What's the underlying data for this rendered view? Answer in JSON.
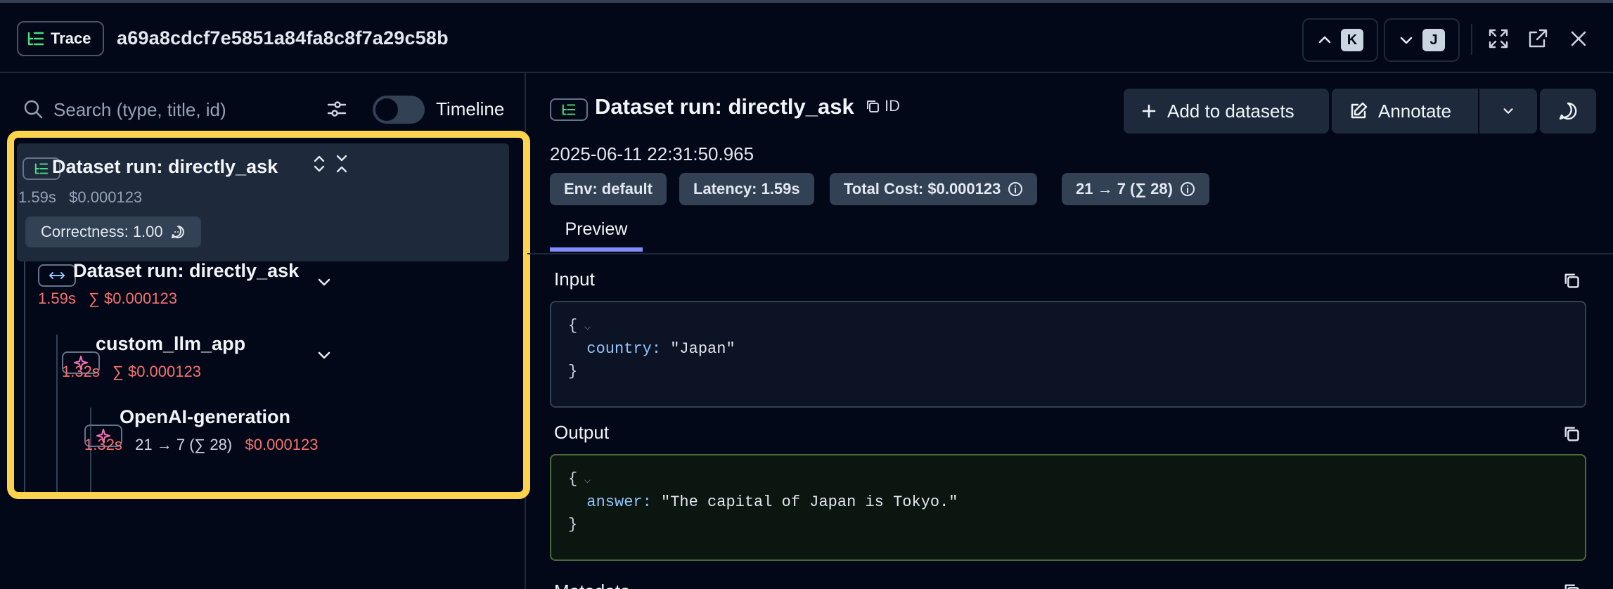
{
  "topbar": {
    "trace_label": "Trace",
    "trace_id": "a69a8cdcf7e5851a84fa8c8f7a29c58b",
    "prev_key": "K",
    "next_key": "J"
  },
  "left": {
    "search_placeholder": "Search (type, title, id)",
    "timeline_label": "Timeline",
    "timeline_on": false,
    "root": {
      "title": "Dataset run: directly_ask",
      "latency": "1.59s",
      "cost": "$0.000123",
      "score": "Correctness: 1.00"
    },
    "children": [
      {
        "title": "Dataset run: directly_ask",
        "latency": "1.59s",
        "cost": "∑ $0.000123"
      },
      {
        "title": "custom_llm_app",
        "latency": "1.32s",
        "cost": "∑ $0.000123"
      },
      {
        "title": "OpenAI-generation",
        "latency": "1.32s",
        "tokens": "21 → 7 (∑ 28)",
        "cost": "$0.000123"
      }
    ]
  },
  "right": {
    "title": "Dataset run: directly_ask",
    "id_label": "ID",
    "add_to_datasets": "Add to datasets",
    "annotate": "Annotate",
    "timestamp": "2025-06-11 22:31:50.965",
    "pills": {
      "env": "Env: default",
      "latency": "Latency: 1.59s",
      "total_cost": "Total Cost: $0.000123",
      "tokens": "21 → 7 (∑ 28)"
    },
    "tab_preview": "Preview",
    "input_label": "Input",
    "input": {
      "open": "{",
      "key": "country:",
      "value": "\"Japan\"",
      "close": "}"
    },
    "output_label": "Output",
    "output": {
      "open": "{",
      "key": "answer:",
      "value": "\"The capital of Japan is Tokyo.\"",
      "close": "}"
    },
    "next_section_label": "Metadata"
  },
  "colors": {
    "background": "#020817",
    "panel": "#1e293b",
    "pill": "#334155",
    "highlight": "#fcd34d",
    "accent_tab": "#818cf8",
    "latency_red": "#f87171",
    "trace_icon": "#4ade80",
    "generation_icon": "#f472b6"
  }
}
